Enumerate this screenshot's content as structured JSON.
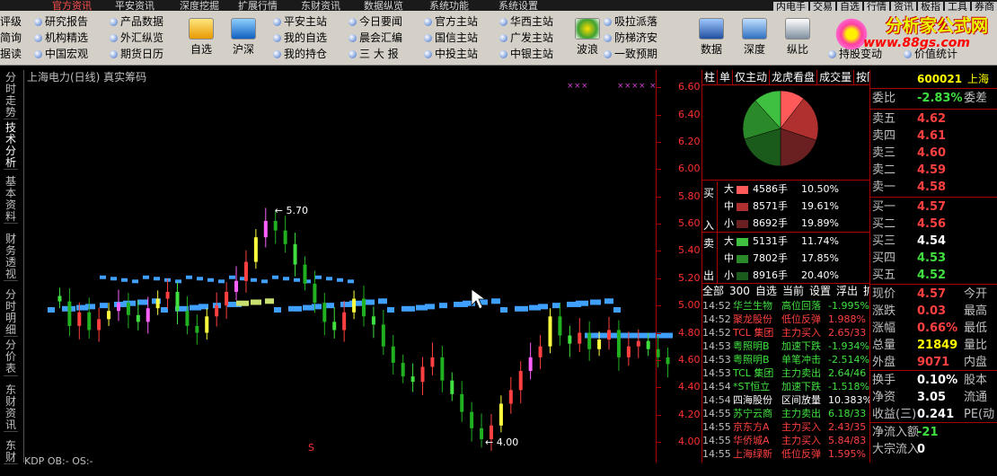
{
  "menubar": {
    "items": [
      "官方资讯",
      "平安资讯",
      "深度挖掘",
      "扩展行情",
      "东财资讯",
      "数据纵览",
      "系统功能",
      "系统设置"
    ],
    "right": [
      "内电手",
      "交易",
      "自选",
      "行情",
      "资讯",
      "板指",
      "工具",
      "券商"
    ]
  },
  "toolbar": {
    "col1": [
      "评级",
      "简询",
      "据读"
    ],
    "col2": [
      "研究报告",
      "机构精选",
      "中国宏观"
    ],
    "col3": [
      "产品数据",
      "外汇纵览",
      "期货日历"
    ],
    "col4": [
      "平安主站",
      "我的自选",
      "我的持仓"
    ],
    "col5": [
      "今日要闻",
      "晨会汇编",
      "三 大 报"
    ],
    "col6": [
      "官方主站",
      "国信主站",
      "中投主站"
    ],
    "col7": [
      "华西主站",
      "广发主站",
      "中银主站"
    ],
    "col8": [
      "吸拉派落",
      "防梯济安",
      "一致预期"
    ],
    "big": [
      "自选",
      "沪深",
      "波浪",
      "数据",
      "深度",
      "纵比"
    ],
    "bottom_right": [
      "持股变动",
      "价值统计"
    ]
  },
  "logo": {
    "title": "分析家公式网",
    "url": "www.88gs.com"
  },
  "left_tabs": [
    "分时走势",
    "技术分析",
    "基本资料",
    "财务透视",
    "分时明细",
    "分价表",
    "东财资讯",
    "东财"
  ],
  "chart": {
    "title": "上海电力(日线) 真实筹码",
    "high_label": "5.70",
    "low_label": "4.00",
    "yticks": [
      "6.60",
      "6.40",
      "6.20",
      "6.00",
      "5.80",
      "5.60",
      "5.40",
      "5.20",
      "5.00",
      "4.80",
      "4.60",
      "4.40",
      "4.20",
      "4.00"
    ],
    "status": "KDP OB:- OS:-",
    "ex_marker": "S"
  },
  "chart_data": {
    "type": "candlestick",
    "title": "上海电力(日线) 真实筹码",
    "ylim": [
      4.0,
      6.7
    ],
    "high": 5.7,
    "low": 4.0,
    "close": [
      5.03,
      4.85,
      4.95,
      4.82,
      4.9,
      4.96,
      5.02,
      4.93,
      4.88,
      4.98,
      5.05,
      5.1,
      4.96,
      4.85,
      4.8,
      4.92,
      5.0,
      5.1,
      5.18,
      5.32,
      5.5,
      5.62,
      5.55,
      5.45,
      5.3,
      5.16,
      5.02,
      4.88,
      4.82,
      4.95,
      5.05,
      4.92,
      4.86,
      4.7,
      4.58,
      4.48,
      4.44,
      4.55,
      4.62,
      4.45,
      4.35,
      4.22,
      4.1,
      4.02,
      4.12,
      4.28,
      4.38,
      4.52,
      4.62,
      4.7,
      4.92,
      4.78,
      4.72,
      4.8,
      4.68,
      4.75,
      4.82,
      4.62,
      4.7,
      4.74,
      4.68,
      4.62,
      4.57
    ]
  },
  "mid_panel": {
    "tabs": [
      "柱",
      "单",
      "仅主动",
      "龙虎看盘",
      "成交量",
      "按阴"
    ],
    "side_buy": [
      "买",
      "入"
    ],
    "side_sell": [
      "卖",
      "出"
    ],
    "buy_rows": [
      {
        "size": "大",
        "vol": "4586手",
        "pct": "10.50%",
        "color": "#ff5a5a"
      },
      {
        "size": "中",
        "vol": "8571手",
        "pct": "19.61%",
        "color": "#b03030"
      },
      {
        "size": "小",
        "vol": "8692手",
        "pct": "19.89%",
        "color": "#6a2020"
      }
    ],
    "sell_rows": [
      {
        "size": "大",
        "vol": "5131手",
        "pct": "11.74%",
        "color": "#40c040"
      },
      {
        "size": "中",
        "vol": "7802手",
        "pct": "17.85%",
        "color": "#2a8a2a"
      },
      {
        "size": "小",
        "vol": "8916手",
        "pct": "20.40%",
        "color": "#1a5a1a"
      }
    ],
    "pie": [
      {
        "value": 10.5,
        "color": "#ff5a5a"
      },
      {
        "value": 19.61,
        "color": "#b03030"
      },
      {
        "value": 19.89,
        "color": "#6a2020"
      },
      {
        "value": 20.4,
        "color": "#1a5a1a"
      },
      {
        "value": 17.85,
        "color": "#2a8a2a"
      },
      {
        "value": 11.74,
        "color": "#40c040"
      }
    ],
    "tick_tabs": [
      "全部",
      "300",
      "自选",
      "当前",
      "设置",
      "浮出",
      "扩"
    ],
    "ticks": [
      {
        "time": "14:52",
        "name": "华兰生物",
        "signal": "高位回落",
        "chg": "-1.995%",
        "color": "#40e040"
      },
      {
        "time": "14:52",
        "name": "聚龙股份",
        "signal": "低位反弹",
        "chg": "1.988%",
        "color": "#ff4040"
      },
      {
        "time": "14:52",
        "name": "TCL 集团",
        "signal": "主力买入",
        "chg": "2.65/33",
        "color": "#ff4040"
      },
      {
        "time": "14:53",
        "name": "粤照明B",
        "signal": "加速下跌",
        "chg": "-1.934%",
        "color": "#40e040"
      },
      {
        "time": "14:53",
        "name": "粤照明B",
        "signal": "单笔冲击",
        "chg": "-2.514%",
        "color": "#40e040"
      },
      {
        "time": "14:53",
        "name": "TCL 集团",
        "signal": "主力卖出",
        "chg": "2.64/46",
        "color": "#40e040"
      },
      {
        "time": "14:54",
        "name": "*ST恒立",
        "signal": "加速下跌",
        "chg": "-1.518%",
        "color": "#40e040"
      },
      {
        "time": "14:54",
        "name": "四海股份",
        "signal": "区间放量",
        "chg": "10.383%",
        "color": "#ffffff"
      },
      {
        "time": "14:55",
        "name": "苏宁云商",
        "signal": "主力卖出",
        "chg": "6.18/33",
        "color": "#40e040"
      },
      {
        "time": "14:55",
        "name": "京东方A",
        "signal": "主力买入",
        "chg": "2.43/35",
        "color": "#ff4040"
      },
      {
        "time": "14:55",
        "name": "华侨城A",
        "signal": "主力买入",
        "chg": "5.84/83",
        "color": "#ff4040"
      },
      {
        "time": "14:55",
        "name": "上海绿新",
        "signal": "低位反弹",
        "chg": "1.595%",
        "color": "#ff4040"
      }
    ]
  },
  "right_panel": {
    "code": "600021",
    "name": "上海",
    "rows": [
      {
        "l": "委比",
        "v": "-2.83%",
        "r": "委差",
        "vc": "#40e040"
      },
      {
        "l": "卖五",
        "v": "4.62",
        "r": "",
        "vc": "#ff4040"
      },
      {
        "l": "卖四",
        "v": "4.61",
        "r": "",
        "vc": "#ff4040"
      },
      {
        "l": "卖三",
        "v": "4.60",
        "r": "",
        "vc": "#ff4040"
      },
      {
        "l": "卖二",
        "v": "4.59",
        "r": "",
        "vc": "#ff4040"
      },
      {
        "l": "卖一",
        "v": "4.58",
        "r": "",
        "vc": "#ff4040"
      },
      {
        "l": "买一",
        "v": "4.57",
        "r": "",
        "vc": "#ff4040"
      },
      {
        "l": "买二",
        "v": "4.56",
        "r": "",
        "vc": "#ff4040"
      },
      {
        "l": "买三",
        "v": "4.54",
        "r": "",
        "vc": "#ffffff"
      },
      {
        "l": "买四",
        "v": "4.53",
        "r": "",
        "vc": "#40e040"
      },
      {
        "l": "买五",
        "v": "4.52",
        "r": "",
        "vc": "#40e040"
      },
      {
        "l": "现价",
        "v": "4.57",
        "r": "今开",
        "vc": "#ff4040"
      },
      {
        "l": "涨跌",
        "v": "0.03",
        "r": "最高",
        "vc": "#ff4040"
      },
      {
        "l": "涨幅",
        "v": "0.66%",
        "r": "最低",
        "vc": "#ff4040"
      },
      {
        "l": "总量",
        "v": "21849",
        "r": "量比",
        "vc": "#ffff00"
      },
      {
        "l": "外盘",
        "v": "9071",
        "r": "内盘",
        "vc": "#ff4040"
      },
      {
        "l": "换手",
        "v": "0.10%",
        "r": "股本",
        "vc": "#ffffff"
      },
      {
        "l": "净资",
        "v": "3.05",
        "r": "流通",
        "vc": "#ffffff"
      },
      {
        "l": "收益(三)",
        "v": "0.241",
        "r": "PE(动",
        "vc": "#ffffff"
      },
      {
        "l": "净流入额",
        "v": "-21",
        "r": "",
        "vc": "#40e040"
      },
      {
        "l": "大宗流入",
        "v": "0",
        "r": "",
        "vc": "#ffffff"
      }
    ]
  }
}
